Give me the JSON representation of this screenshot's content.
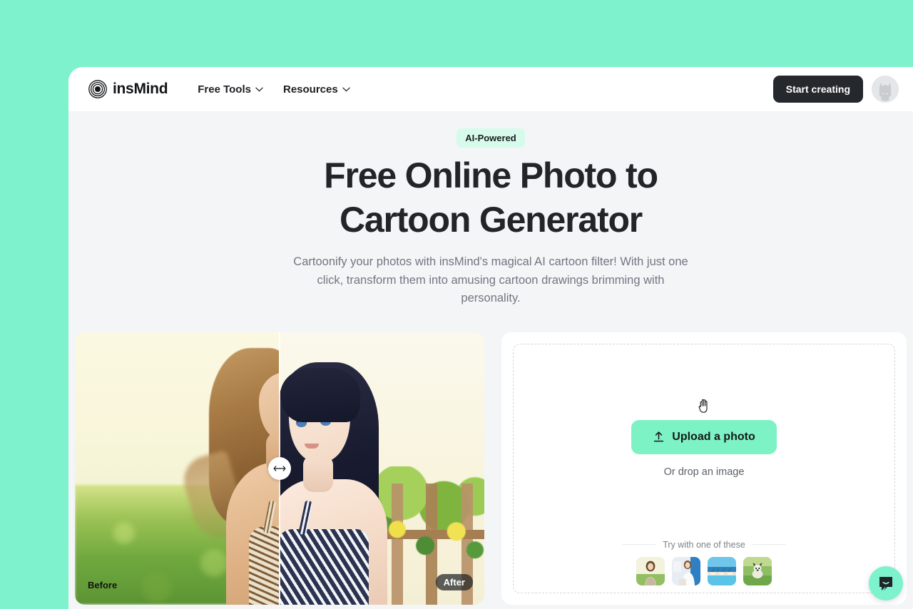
{
  "theme": {
    "mint_background": "#7EF2CC",
    "page_background": "#F4F5F7",
    "accent_mint": "#7DF2C4",
    "badge_mint": "#D6FBEB",
    "dark": "#25282C"
  },
  "header": {
    "brand_name": "insMind",
    "brand_logo_icon": "concentric-rings-logo",
    "nav": [
      {
        "label": "Free Tools",
        "icon": "chevron-down-icon"
      },
      {
        "label": "Resources",
        "icon": "chevron-down-icon"
      }
    ],
    "cta_label": "Start creating",
    "avatar_icon": "github-octocat-avatar"
  },
  "hero": {
    "badge": "AI-Powered",
    "title_line1": "Free Online Photo to",
    "title_line2": "Cartoon Generator",
    "subtitle": "Cartoonify your photos with insMind's magical AI cartoon filter! With just one click, transform them into amusing cartoon drawings brimming with personality."
  },
  "comparison": {
    "before_label": "Before",
    "after_label": "After",
    "handle_icon": "left-right-arrow-icon",
    "divider_position_percent": 50,
    "before_description": "photo of a woman with long brown hair standing in a sunlit green field",
    "after_description": "anime-style cartoon illustration of the same woman with dark blue hair and a garden fence background"
  },
  "upload": {
    "cursor_icon": "hand-cursor-icon",
    "button_icon": "upload-arrow-icon",
    "button_label": "Upload a photo",
    "drop_hint": "Or drop an image",
    "try_label": "Try with one of these",
    "samples": [
      {
        "name": "sample-woman-field",
        "icon": "thumbnail-woman-field"
      },
      {
        "name": "sample-woman-wall",
        "icon": "thumbnail-woman-wall"
      },
      {
        "name": "sample-pool-palms",
        "icon": "thumbnail-pool-palms"
      },
      {
        "name": "sample-dog-grass",
        "icon": "thumbnail-dog-grass"
      }
    ]
  },
  "chat": {
    "icon": "chat-bubble-smile-icon"
  }
}
